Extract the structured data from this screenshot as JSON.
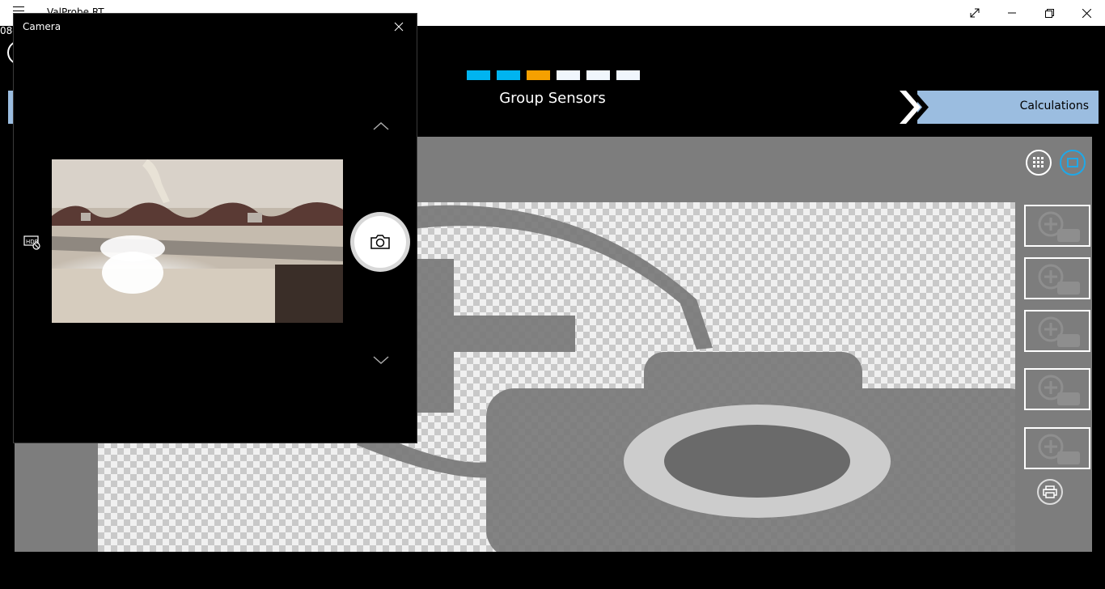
{
  "window": {
    "app_title": "ValProbe RT",
    "controls": {
      "expand_icon": "expand-icon",
      "minimize_icon": "minimize-icon",
      "restore_icon": "restore-icon",
      "close_icon": "close-icon"
    }
  },
  "app": {
    "left_partial_text": "08-",
    "progress": {
      "segments": [
        {
          "state": "complete",
          "color": "#00b4f0"
        },
        {
          "state": "complete",
          "color": "#00b4f0"
        },
        {
          "state": "current",
          "color": "#f5a000"
        },
        {
          "state": "pending",
          "color": "#f0f6fc"
        },
        {
          "state": "pending",
          "color": "#f0f6fc"
        },
        {
          "state": "pending",
          "color": "#f0f6fc"
        }
      ]
    },
    "step_title": "Group Sensors",
    "next_nav": {
      "label": "Calculations",
      "icon": "chevron-right-icon",
      "color": "#9bbde0"
    },
    "photo_panel": {
      "placeholder_icon": "camera-placeholder-icon",
      "toolbar": {
        "grid_icon": "grid-icon",
        "view_icon": "view-icon"
      },
      "thumbnails": [
        {
          "icon": "add-photo-icon"
        },
        {
          "icon": "add-photo-icon"
        },
        {
          "icon": "add-photo-icon"
        },
        {
          "icon": "add-photo-icon"
        },
        {
          "icon": "add-photo-icon"
        }
      ],
      "print_icon": "print-icon"
    }
  },
  "camera_dialog": {
    "title": "Camera",
    "close_icon": "close-icon",
    "hdr_icon": "hdr-off-icon",
    "up_icon": "chevron-up-icon",
    "down_icon": "chevron-down-icon",
    "shutter_icon": "camera-icon"
  }
}
